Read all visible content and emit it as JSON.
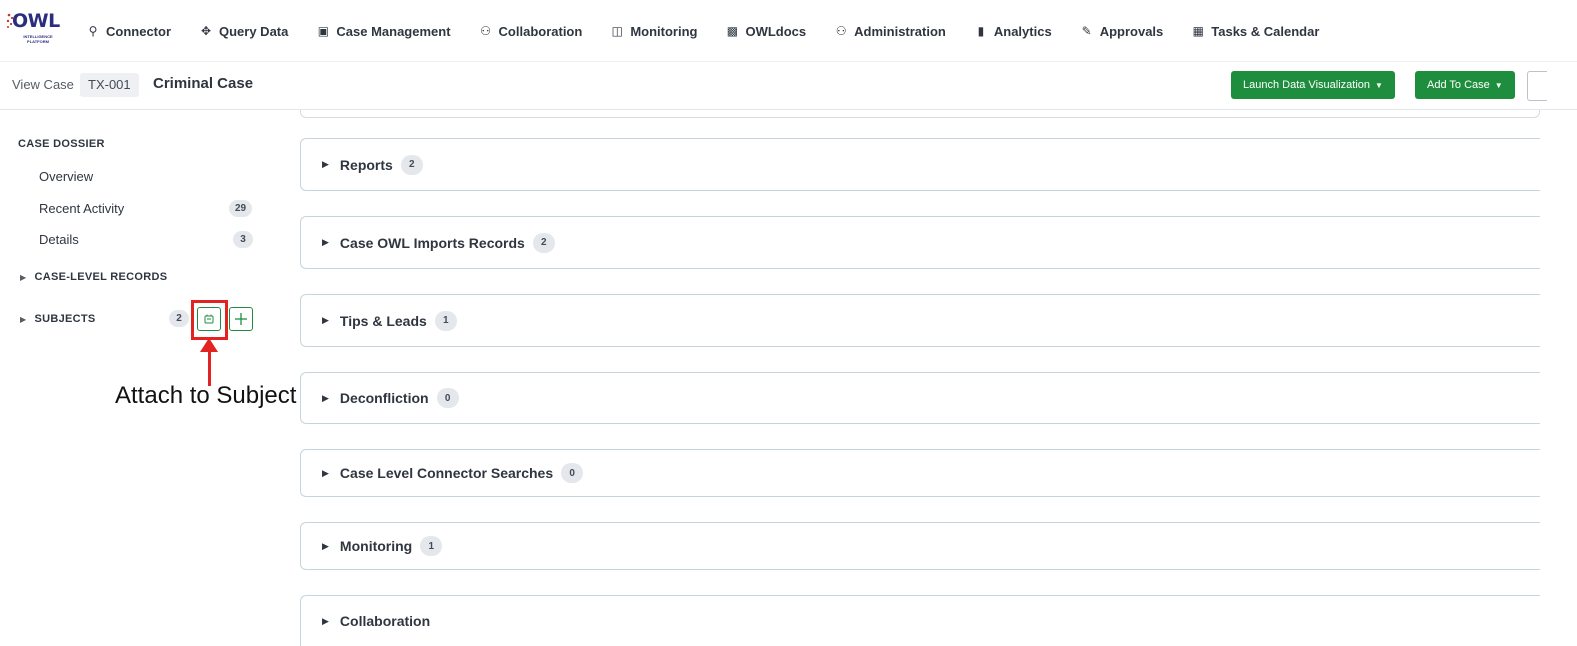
{
  "nav": {
    "logo_text": "OWL",
    "logo_tagline": "INTELLIGENCE PLATFORM",
    "items": [
      {
        "label": "Connector",
        "icon": "search-icon"
      },
      {
        "label": "Query Data",
        "icon": "move-icon"
      },
      {
        "label": "Case Management",
        "icon": "briefcase-icon"
      },
      {
        "label": "Collaboration",
        "icon": "users-icon"
      },
      {
        "label": "Monitoring",
        "icon": "monitor-icon"
      },
      {
        "label": "OWLdocs",
        "icon": "document-icon"
      },
      {
        "label": "Administration",
        "icon": "admin-users-icon"
      },
      {
        "label": "Analytics",
        "icon": "file-icon"
      },
      {
        "label": "Approvals",
        "icon": "approval-icon"
      },
      {
        "label": "Tasks & Calendar",
        "icon": "calendar-icon"
      }
    ]
  },
  "subheader": {
    "view_case_label": "View Case",
    "case_id": "TX-001",
    "case_title": "Criminal Case",
    "launch_label": "Launch Data Visualization",
    "add_label": "Add To Case"
  },
  "sidebar": {
    "heading": "CASE DOSSIER",
    "items": [
      {
        "label": "Overview",
        "count": ""
      },
      {
        "label": "Recent Activity",
        "count": "29"
      },
      {
        "label": "Details",
        "count": "3"
      }
    ],
    "case_level_records": "CASE-LEVEL RECORDS",
    "subjects": {
      "label": "SUBJECTS",
      "count": "2"
    }
  },
  "annotation": {
    "text": "Attach to Subject",
    "color": "#e32222"
  },
  "panels": [
    {
      "title": "Reports",
      "count": "2"
    },
    {
      "title": "Case OWL Imports Records",
      "count": "2"
    },
    {
      "title": "Tips & Leads",
      "count": "1"
    },
    {
      "title": "Deconfliction",
      "count": "0"
    },
    {
      "title": "Case Level Connector Searches",
      "count": "0"
    },
    {
      "title": "Monitoring",
      "count": "1"
    },
    {
      "title": "Collaboration",
      "count": ""
    }
  ],
  "colors": {
    "accent_green": "#1e8e3e",
    "annotation_red": "#e32222",
    "logo_blue": "#2b2d7f"
  }
}
